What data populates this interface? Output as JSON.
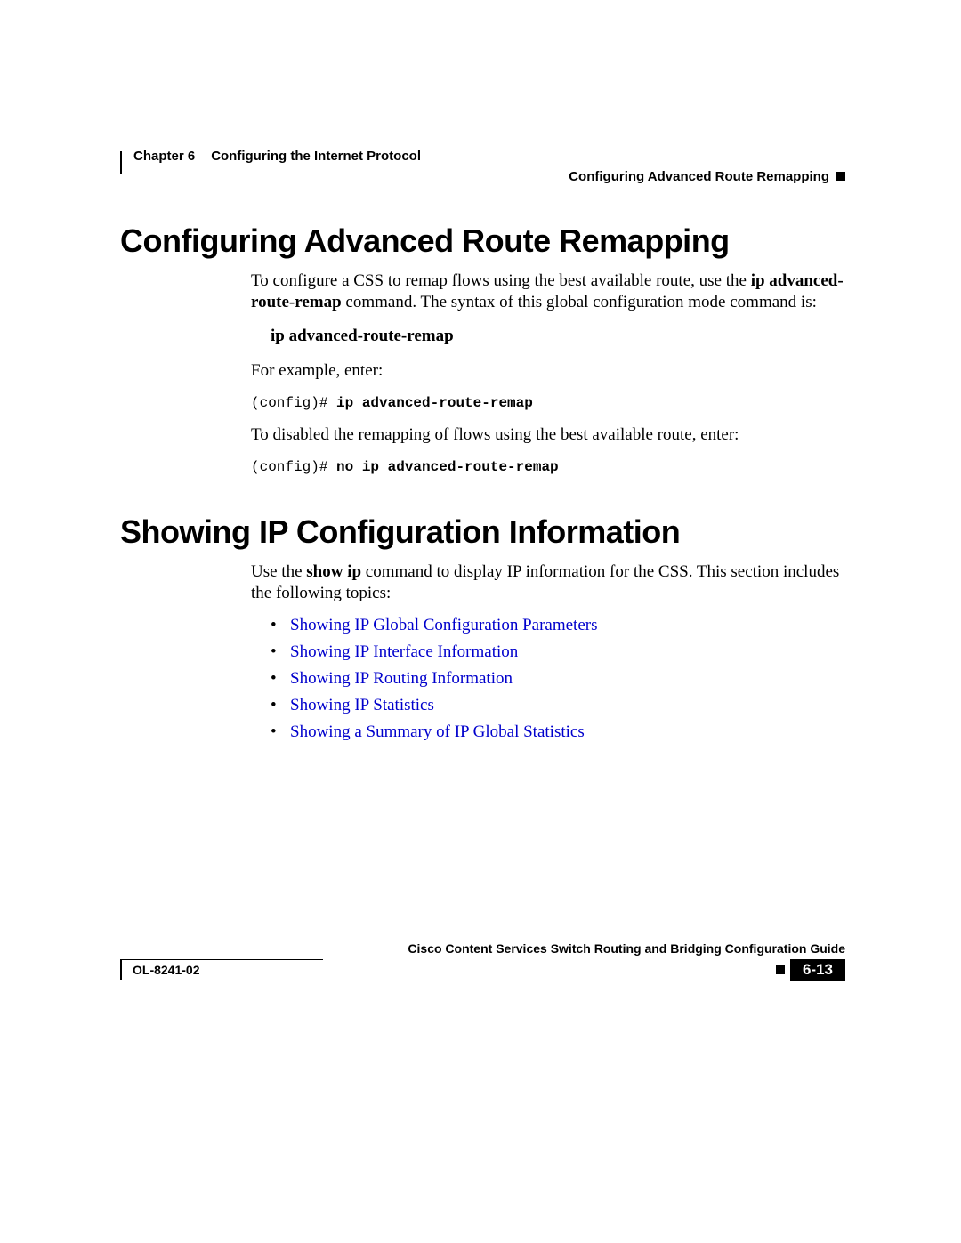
{
  "header": {
    "chapter_label": "Chapter 6",
    "chapter_title": "Configuring the Internet Protocol",
    "section_title": "Configuring Advanced Route Remapping"
  },
  "section1": {
    "title": "Configuring Advanced Route Remapping",
    "p1_a": "To configure a CSS to remap flows using the best available route, use the ",
    "p1_b": "ip advanced-route-remap",
    "p1_c": " command. The syntax of this global configuration mode command is:",
    "syntax": "ip advanced-route-remap",
    "p2": "For example, enter:",
    "code1_prefix": "(config)# ",
    "code1_cmd": "ip advanced-route-remap",
    "p3": "To disabled the remapping of flows using the best available route, enter:",
    "code2_prefix": "(config)# ",
    "code2_cmd": "no ip advanced-route-remap"
  },
  "section2": {
    "title": "Showing IP Configuration Information",
    "p1_a": "Use the ",
    "p1_b": "show ip",
    "p1_c": " command to display IP information for the CSS. This section includes the following topics:",
    "links": [
      "Showing IP Global Configuration Parameters",
      "Showing IP Interface Information",
      "Showing IP Routing Information",
      "Showing IP Statistics",
      "Showing a Summary of IP Global Statistics"
    ]
  },
  "footer": {
    "guide": "Cisco Content Services Switch Routing and Bridging Configuration Guide",
    "doc_id": "OL-8241-02",
    "page": "6-13"
  }
}
